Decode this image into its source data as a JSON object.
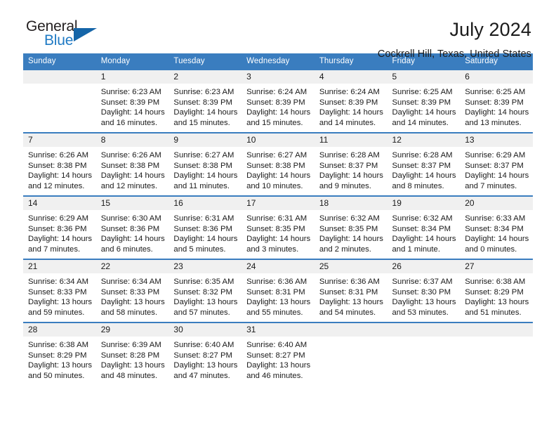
{
  "logo": {
    "line1": "General",
    "line2": "Blue",
    "triangle_icon": "triangle-icon",
    "colors": {
      "dark": "#231f20",
      "blue": "#1f7ac4",
      "triangle": "#1565a8"
    }
  },
  "header": {
    "title": "July 2024",
    "subtitle": "Cockrell Hill, Texas, United States"
  },
  "calendar": {
    "accent_color": "#3a7dbf",
    "daynum_bg": "#f0f0f0",
    "weekdays": [
      "Sunday",
      "Monday",
      "Tuesday",
      "Wednesday",
      "Thursday",
      "Friday",
      "Saturday"
    ],
    "weeks": [
      [
        {
          "day": "",
          "lines": []
        },
        {
          "day": "1",
          "lines": [
            "Sunrise: 6:23 AM",
            "Sunset: 8:39 PM",
            "Daylight: 14 hours",
            "and 16 minutes."
          ]
        },
        {
          "day": "2",
          "lines": [
            "Sunrise: 6:23 AM",
            "Sunset: 8:39 PM",
            "Daylight: 14 hours",
            "and 15 minutes."
          ]
        },
        {
          "day": "3",
          "lines": [
            "Sunrise: 6:24 AM",
            "Sunset: 8:39 PM",
            "Daylight: 14 hours",
            "and 15 minutes."
          ]
        },
        {
          "day": "4",
          "lines": [
            "Sunrise: 6:24 AM",
            "Sunset: 8:39 PM",
            "Daylight: 14 hours",
            "and 14 minutes."
          ]
        },
        {
          "day": "5",
          "lines": [
            "Sunrise: 6:25 AM",
            "Sunset: 8:39 PM",
            "Daylight: 14 hours",
            "and 14 minutes."
          ]
        },
        {
          "day": "6",
          "lines": [
            "Sunrise: 6:25 AM",
            "Sunset: 8:39 PM",
            "Daylight: 14 hours",
            "and 13 minutes."
          ]
        }
      ],
      [
        {
          "day": "7",
          "lines": [
            "Sunrise: 6:26 AM",
            "Sunset: 8:38 PM",
            "Daylight: 14 hours",
            "and 12 minutes."
          ]
        },
        {
          "day": "8",
          "lines": [
            "Sunrise: 6:26 AM",
            "Sunset: 8:38 PM",
            "Daylight: 14 hours",
            "and 12 minutes."
          ]
        },
        {
          "day": "9",
          "lines": [
            "Sunrise: 6:27 AM",
            "Sunset: 8:38 PM",
            "Daylight: 14 hours",
            "and 11 minutes."
          ]
        },
        {
          "day": "10",
          "lines": [
            "Sunrise: 6:27 AM",
            "Sunset: 8:38 PM",
            "Daylight: 14 hours",
            "and 10 minutes."
          ]
        },
        {
          "day": "11",
          "lines": [
            "Sunrise: 6:28 AM",
            "Sunset: 8:37 PM",
            "Daylight: 14 hours",
            "and 9 minutes."
          ]
        },
        {
          "day": "12",
          "lines": [
            "Sunrise: 6:28 AM",
            "Sunset: 8:37 PM",
            "Daylight: 14 hours",
            "and 8 minutes."
          ]
        },
        {
          "day": "13",
          "lines": [
            "Sunrise: 6:29 AM",
            "Sunset: 8:37 PM",
            "Daylight: 14 hours",
            "and 7 minutes."
          ]
        }
      ],
      [
        {
          "day": "14",
          "lines": [
            "Sunrise: 6:29 AM",
            "Sunset: 8:36 PM",
            "Daylight: 14 hours",
            "and 7 minutes."
          ]
        },
        {
          "day": "15",
          "lines": [
            "Sunrise: 6:30 AM",
            "Sunset: 8:36 PM",
            "Daylight: 14 hours",
            "and 6 minutes."
          ]
        },
        {
          "day": "16",
          "lines": [
            "Sunrise: 6:31 AM",
            "Sunset: 8:36 PM",
            "Daylight: 14 hours",
            "and 5 minutes."
          ]
        },
        {
          "day": "17",
          "lines": [
            "Sunrise: 6:31 AM",
            "Sunset: 8:35 PM",
            "Daylight: 14 hours",
            "and 3 minutes."
          ]
        },
        {
          "day": "18",
          "lines": [
            "Sunrise: 6:32 AM",
            "Sunset: 8:35 PM",
            "Daylight: 14 hours",
            "and 2 minutes."
          ]
        },
        {
          "day": "19",
          "lines": [
            "Sunrise: 6:32 AM",
            "Sunset: 8:34 PM",
            "Daylight: 14 hours",
            "and 1 minute."
          ]
        },
        {
          "day": "20",
          "lines": [
            "Sunrise: 6:33 AM",
            "Sunset: 8:34 PM",
            "Daylight: 14 hours",
            "and 0 minutes."
          ]
        }
      ],
      [
        {
          "day": "21",
          "lines": [
            "Sunrise: 6:34 AM",
            "Sunset: 8:33 PM",
            "Daylight: 13 hours",
            "and 59 minutes."
          ]
        },
        {
          "day": "22",
          "lines": [
            "Sunrise: 6:34 AM",
            "Sunset: 8:33 PM",
            "Daylight: 13 hours",
            "and 58 minutes."
          ]
        },
        {
          "day": "23",
          "lines": [
            "Sunrise: 6:35 AM",
            "Sunset: 8:32 PM",
            "Daylight: 13 hours",
            "and 57 minutes."
          ]
        },
        {
          "day": "24",
          "lines": [
            "Sunrise: 6:36 AM",
            "Sunset: 8:31 PM",
            "Daylight: 13 hours",
            "and 55 minutes."
          ]
        },
        {
          "day": "25",
          "lines": [
            "Sunrise: 6:36 AM",
            "Sunset: 8:31 PM",
            "Daylight: 13 hours",
            "and 54 minutes."
          ]
        },
        {
          "day": "26",
          "lines": [
            "Sunrise: 6:37 AM",
            "Sunset: 8:30 PM",
            "Daylight: 13 hours",
            "and 53 minutes."
          ]
        },
        {
          "day": "27",
          "lines": [
            "Sunrise: 6:38 AM",
            "Sunset: 8:29 PM",
            "Daylight: 13 hours",
            "and 51 minutes."
          ]
        }
      ],
      [
        {
          "day": "28",
          "lines": [
            "Sunrise: 6:38 AM",
            "Sunset: 8:29 PM",
            "Daylight: 13 hours",
            "and 50 minutes."
          ]
        },
        {
          "day": "29",
          "lines": [
            "Sunrise: 6:39 AM",
            "Sunset: 8:28 PM",
            "Daylight: 13 hours",
            "and 48 minutes."
          ]
        },
        {
          "day": "30",
          "lines": [
            "Sunrise: 6:40 AM",
            "Sunset: 8:27 PM",
            "Daylight: 13 hours",
            "and 47 minutes."
          ]
        },
        {
          "day": "31",
          "lines": [
            "Sunrise: 6:40 AM",
            "Sunset: 8:27 PM",
            "Daylight: 13 hours",
            "and 46 minutes."
          ]
        },
        {
          "day": "",
          "lines": []
        },
        {
          "day": "",
          "lines": []
        },
        {
          "day": "",
          "lines": []
        }
      ]
    ]
  }
}
